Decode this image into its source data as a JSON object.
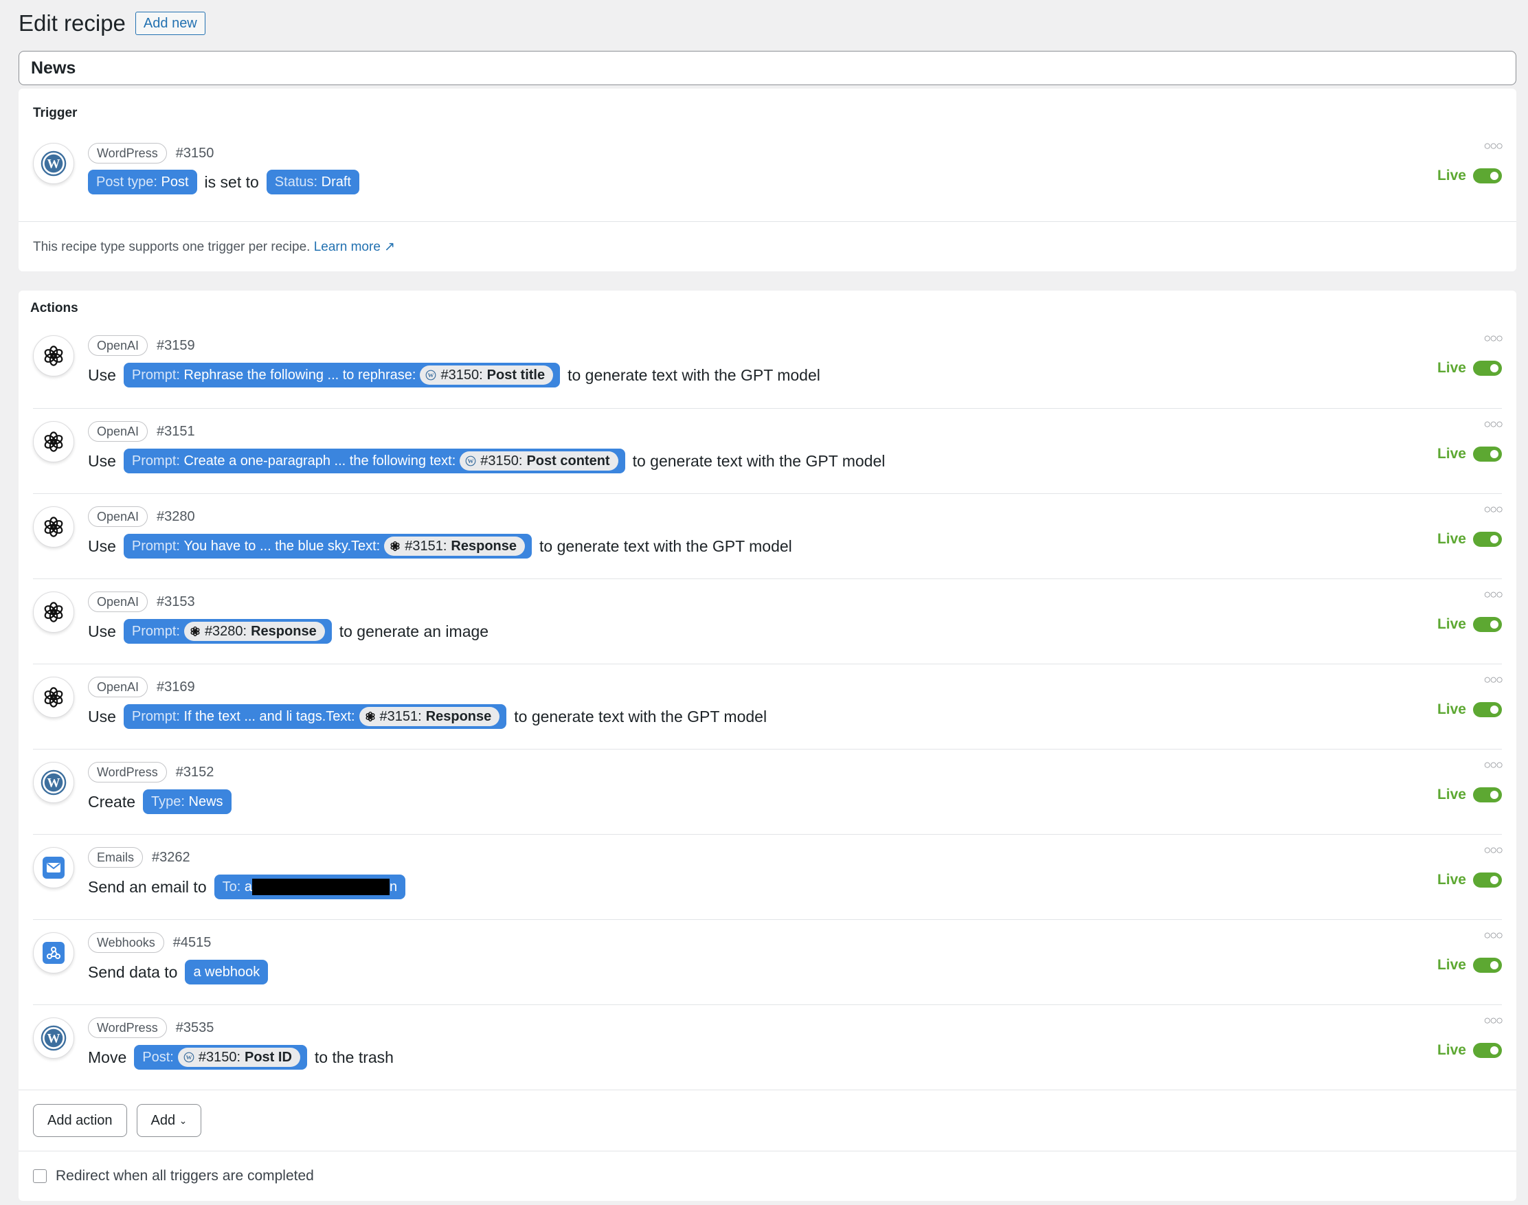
{
  "header": {
    "title": "Edit recipe",
    "add_new": "Add new"
  },
  "recipe_title": "News",
  "trigger": {
    "heading": "Trigger",
    "integration": "WordPress",
    "id": "#3150",
    "token1": {
      "label": "Post type:",
      "value": "Post"
    },
    "middle": "is set to",
    "token2": {
      "label": "Status:",
      "value": "Draft"
    },
    "status": "Live",
    "note": "This recipe type supports one trigger per recipe.",
    "learn_more": "Learn more"
  },
  "actions": {
    "heading": "Actions",
    "items": [
      {
        "integration": "OpenAI",
        "id": "#3159",
        "verb": "Use",
        "token_label": "Prompt:",
        "token_value": "Rephrase the following ... to rephrase:",
        "sub_icon": "wordpress-icon",
        "sub_id": "#3150:",
        "sub_name": "Post title",
        "after": "to generate text with the GPT model",
        "status": "Live"
      },
      {
        "integration": "OpenAI",
        "id": "#3151",
        "verb": "Use",
        "token_label": "Prompt:",
        "token_value": "Create a one-paragraph ... the following text:",
        "sub_icon": "wordpress-icon",
        "sub_id": "#3150:",
        "sub_name": "Post content",
        "after": "to generate text with the GPT model",
        "status": "Live"
      },
      {
        "integration": "OpenAI",
        "id": "#3280",
        "verb": "Use",
        "token_label": "Prompt:",
        "token_value": "You have to ... the blue sky.Text:",
        "sub_icon": "openai-icon",
        "sub_id": "#3151:",
        "sub_name": "Response",
        "after": "to generate text with the GPT model",
        "status": "Live"
      },
      {
        "integration": "OpenAI",
        "id": "#3153",
        "verb": "Use",
        "token_label": "Prompt:",
        "token_value": "",
        "sub_icon": "openai-icon",
        "sub_id": "#3280:",
        "sub_name": "Response",
        "after": "to generate an image",
        "status": "Live"
      },
      {
        "integration": "OpenAI",
        "id": "#3169",
        "verb": "Use",
        "token_label": "Prompt:",
        "token_value": "If the text ... and li tags.Text:",
        "sub_icon": "openai-icon",
        "sub_id": "#3151:",
        "sub_name": "Response",
        "after": "to generate text with the GPT model",
        "status": "Live"
      },
      {
        "integration": "WordPress",
        "id": "#3152",
        "verb": "Create",
        "token_label": "Type:",
        "token_value": "News",
        "after": "",
        "status": "Live"
      },
      {
        "integration": "Emails",
        "id": "#3262",
        "verb": "Send an email to",
        "token_label": "To:",
        "token_prefix": "a",
        "token_suffix": "n",
        "after": "",
        "status": "Live"
      },
      {
        "integration": "Webhooks",
        "id": "#4515",
        "verb": "Send data to",
        "token_value": "a webhook",
        "after": "",
        "status": "Live"
      },
      {
        "integration": "WordPress",
        "id": "#3535",
        "verb": "Move",
        "token_label": "Post:",
        "sub_icon": "wordpress-icon",
        "sub_id": "#3150:",
        "sub_name": "Post ID",
        "after": "to the trash",
        "status": "Live"
      }
    ]
  },
  "footer": {
    "add_action": "Add action",
    "add": "Add",
    "redirect_label": "Redirect when all triggers are completed"
  },
  "colors": {
    "token": "#3b85de",
    "live": "#5da832",
    "link": "#2271b1"
  }
}
